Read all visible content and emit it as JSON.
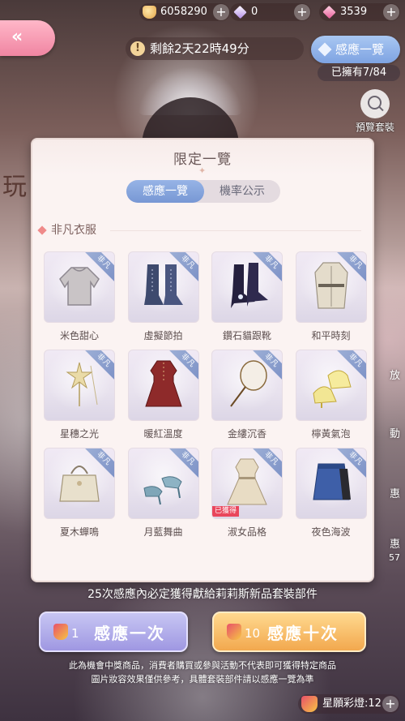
{
  "currencies": {
    "gold": {
      "value": "6058290",
      "icon": "gold-coin-icon"
    },
    "gem": {
      "value": "0",
      "icon": "purple-crystal-icon"
    },
    "diamond": {
      "value": "3539",
      "icon": "pink-diamond-icon"
    }
  },
  "back": {
    "icon": "double-chevron-left-icon",
    "glyph": "«"
  },
  "timer": {
    "text": "剩餘2天22時49分",
    "icon_glyph": "!"
  },
  "overview_button": {
    "label": "感應一覽"
  },
  "owned_text": "已擁有7/84",
  "preview": {
    "label": "預覽套裝"
  },
  "side_left_glyph": "玩",
  "side_right": [
    "放",
    "動",
    "惠",
    "惠",
    "57"
  ],
  "modal": {
    "title": "限定一覽",
    "tabs": [
      {
        "label": "感應一覽",
        "active": true
      },
      {
        "label": "機率公示",
        "active": false
      }
    ],
    "section_title": "非凡衣服",
    "ribbon_text": "非凡",
    "obtained_text": "已獲得",
    "items": [
      {
        "name": "米色甜心",
        "type": "blouse",
        "obtained": false
      },
      {
        "name": "虛擬節拍",
        "type": "boots",
        "obtained": false
      },
      {
        "name": "鑽石貓跟靴",
        "type": "heeled-boots",
        "obtained": false
      },
      {
        "name": "和平時刻",
        "type": "coat",
        "obtained": false
      },
      {
        "name": "星穗之光",
        "type": "hairpin",
        "obtained": false
      },
      {
        "name": "暖紅溫度",
        "type": "red-dress",
        "obtained": false
      },
      {
        "name": "金縷沉香",
        "type": "hand-fan",
        "obtained": false
      },
      {
        "name": "檸黃氣泡",
        "type": "sandals",
        "obtained": false
      },
      {
        "name": "夏木蟬鳴",
        "type": "handbag",
        "obtained": false
      },
      {
        "name": "月藍舞曲",
        "type": "blue-heels",
        "obtained": false
      },
      {
        "name": "淑女品格",
        "type": "beige-dress",
        "obtained": true
      },
      {
        "name": "夜色海波",
        "type": "denim-skirt",
        "obtained": false
      }
    ]
  },
  "guarantee_text": "25次感應內必定獲得獻給莉莉斯新品套裝部件",
  "draw_one": {
    "count": "1",
    "label": "感應一次"
  },
  "draw_ten": {
    "count": "10",
    "label": "感應十次"
  },
  "disclaimer": [
    "此為機會中獎商品，消費者購買或參與活動不代表即可獲得特定商品",
    "圖片妝容效果僅供參考，具體套裝部件請以感應一覽為準"
  ],
  "wish_lamp": {
    "text": "星願彩燈:12"
  }
}
